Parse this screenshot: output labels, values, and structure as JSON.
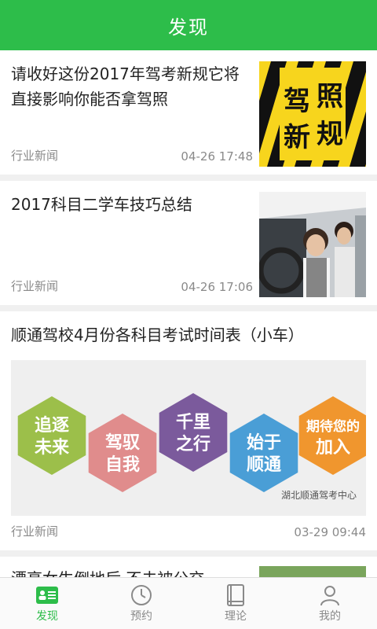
{
  "header": {
    "title": "发现"
  },
  "feed": {
    "items": [
      {
        "title": "请收好这份2017年驾考新规它将直接影响你能否拿驾照",
        "tag": "行业新闻",
        "time": "04-26 17:48",
        "thumb_text": [
          "驾",
          "照",
          "新",
          "规"
        ]
      },
      {
        "title": "2017科目二学车技巧总结",
        "tag": "行业新闻",
        "time": "04-26 17:06"
      },
      {
        "title": "顺通驾校4月份各科目考试时间表（小车）",
        "tag": "行业新闻",
        "time": "03-29 09:44",
        "banner": {
          "hexagons": [
            {
              "line1": "追逐",
              "line2": "未来",
              "color": "#9cbf4a"
            },
            {
              "line1": "驾驭",
              "line2": "自我",
              "color": "#e08c8c"
            },
            {
              "line1": "千里",
              "line2": "之行",
              "color": "#7b5a9c"
            },
            {
              "line1": "始于",
              "line2": "顺通",
              "color": "#4a9ed6"
            },
            {
              "line1": "期待您的",
              "line2": "加入",
              "color": "#f0962e"
            }
          ],
          "watermark": "湖北顺通驾考中心"
        }
      },
      {
        "title": "漂亮女生倒地后 不去被公交"
      }
    ]
  },
  "tabbar": {
    "tabs": [
      {
        "label": "发现",
        "active": true
      },
      {
        "label": "预约",
        "active": false
      },
      {
        "label": "理论",
        "active": false
      },
      {
        "label": "我的",
        "active": false
      }
    ]
  },
  "colors": {
    "brand": "#2dbd4a",
    "muted": "#8a8a8a"
  }
}
